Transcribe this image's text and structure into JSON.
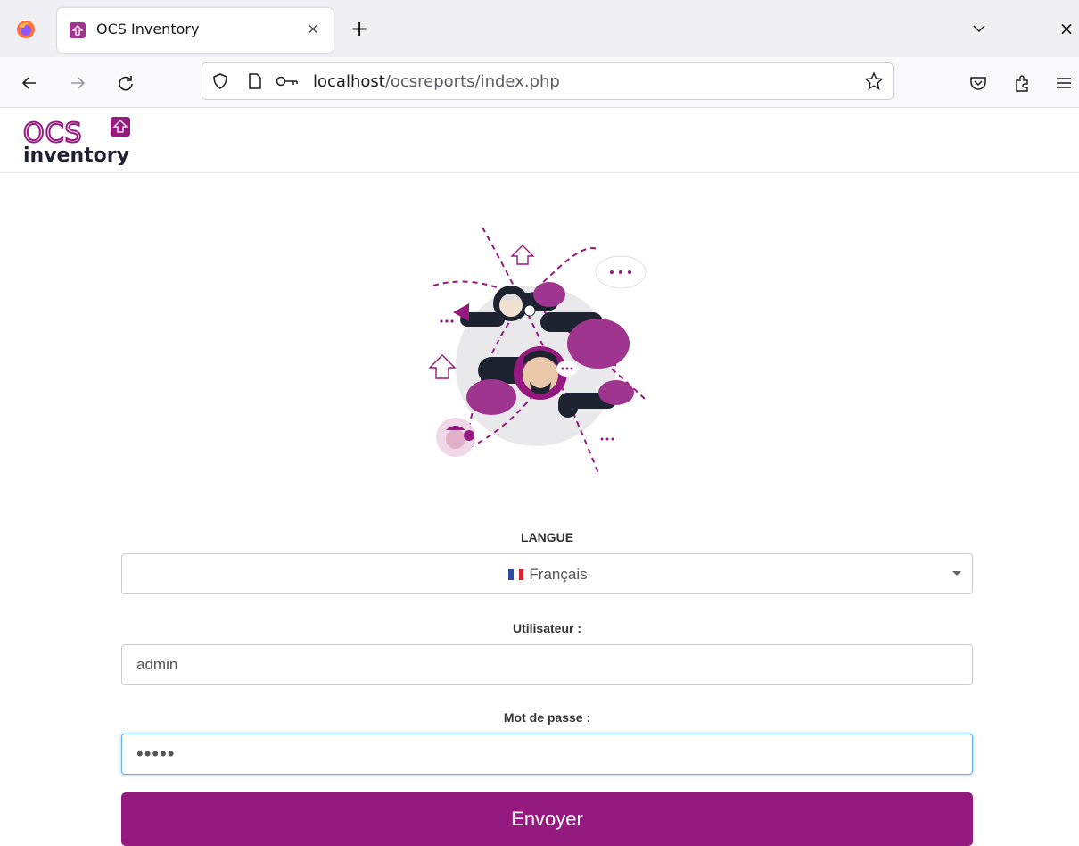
{
  "browser": {
    "tab_title": "OCS Inventory",
    "tab_close": "×",
    "new_tab": "+",
    "window_close": "×",
    "url_host": "localhost",
    "url_path": "/ocsreports/index.php"
  },
  "header": {
    "logo_text_top": "OCS",
    "logo_text_bottom": "inventory"
  },
  "form": {
    "language_label": "LANGUE",
    "language_value": "Français",
    "language_flag": "flag-fr-icon",
    "user_label": "Utilisateur :",
    "user_value": "admin",
    "password_label": "Mot de passe :",
    "password_value": "•••••",
    "submit_label": "Envoyer"
  },
  "colors": {
    "brand": "#951a80",
    "brand_light": "#a0358f",
    "dark": "#1e2332",
    "focus": "#66afe9"
  },
  "icons": [
    "firefox-icon",
    "back-icon",
    "forward-icon",
    "reload-icon",
    "shield-icon",
    "page-icon",
    "key-icon",
    "bookmark-star-icon",
    "pocket-icon",
    "extensions-icon",
    "menu-icon",
    "tab-list-chevron-icon"
  ]
}
